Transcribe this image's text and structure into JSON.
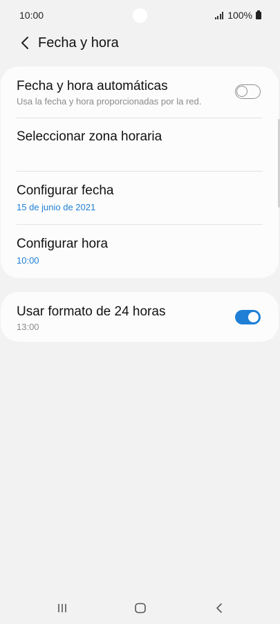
{
  "status_bar": {
    "time": "10:00",
    "battery_text": "100%"
  },
  "header": {
    "title": "Fecha y hora"
  },
  "settings": {
    "auto_datetime": {
      "title": "Fecha y hora automáticas",
      "subtitle": "Usa la fecha y hora proporcionadas por la red.",
      "enabled": false
    },
    "timezone": {
      "title": "Seleccionar zona horaria"
    },
    "set_date": {
      "title": "Configurar fecha",
      "value": "15 de junio de 2021"
    },
    "set_time": {
      "title": "Configurar hora",
      "value": "10:00"
    },
    "format_24h": {
      "title": "Usar formato de 24 horas",
      "subtitle": "13:00",
      "enabled": true
    }
  },
  "colors": {
    "accent": "#1f7fd6",
    "background": "#f2f2f2",
    "card": "#fcfcfc"
  },
  "nav_bar": {
    "icons": [
      "recents-icon",
      "home-icon",
      "back-icon"
    ]
  }
}
